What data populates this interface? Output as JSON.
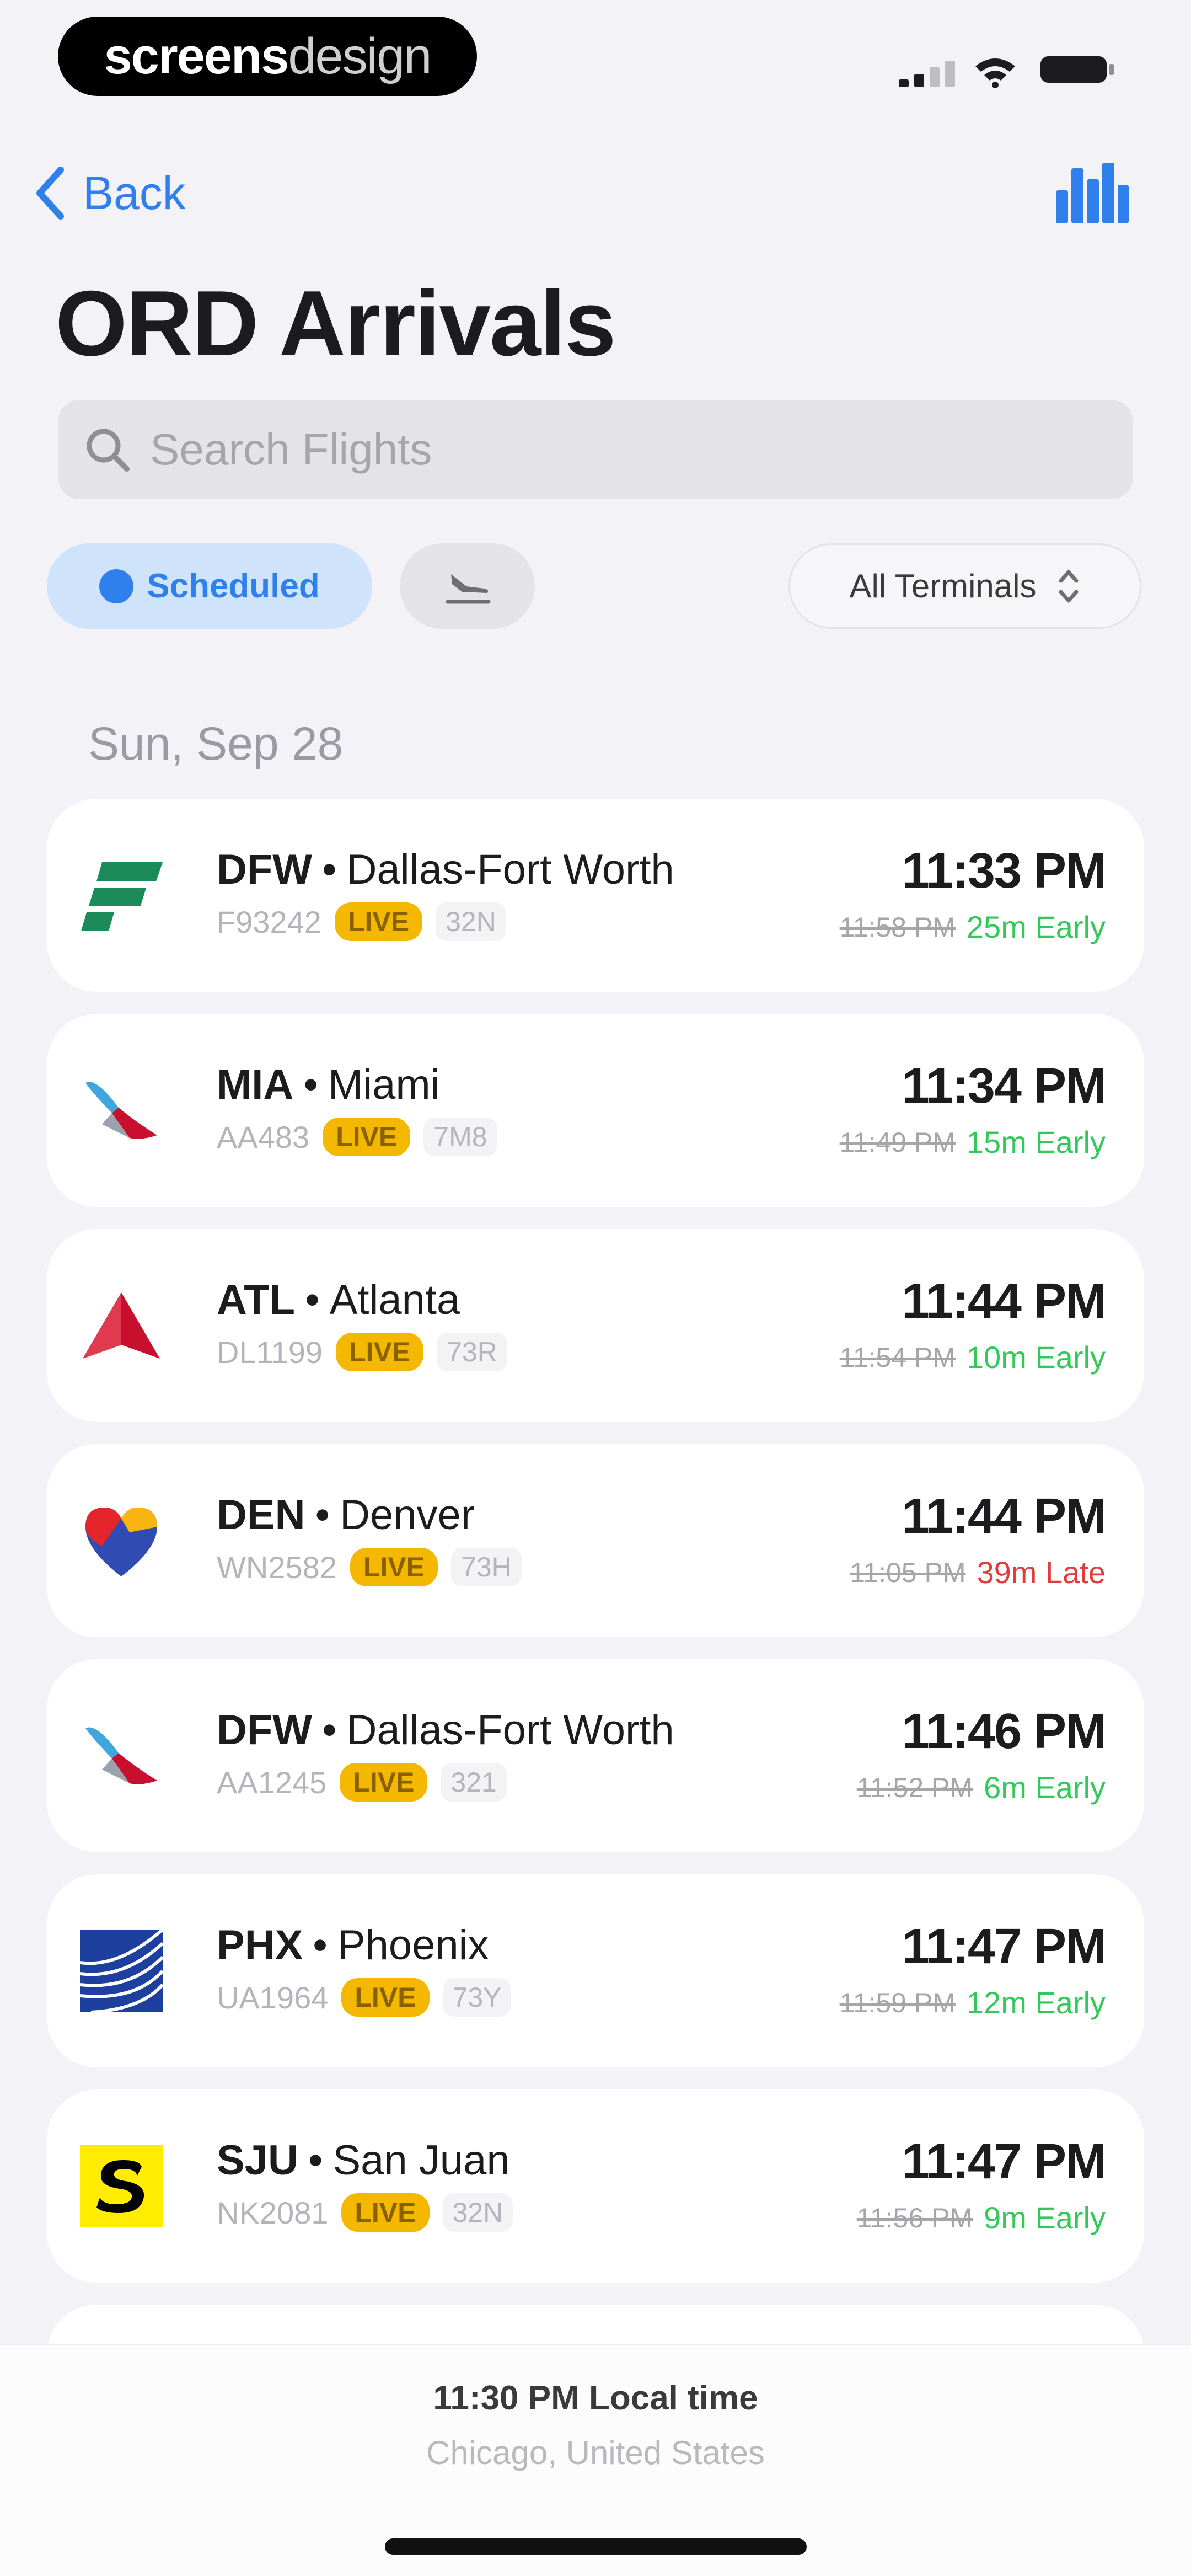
{
  "status_bar": {
    "brand_bold": "screens",
    "brand_light": "design"
  },
  "nav": {
    "back_label": "Back"
  },
  "page_title": "ORD Arrivals",
  "search": {
    "placeholder": "Search Flights"
  },
  "filters": {
    "scheduled_label": "Scheduled",
    "terminal_label": "All Terminals"
  },
  "section_date": "Sun, Sep 28",
  "flights": [
    {
      "code": "DFW",
      "city": "Dallas-Fort Worth",
      "flight": "F93242",
      "status": "LIVE",
      "aircraft": "32N",
      "time": "11:33 PM",
      "scheduled": "11:58 PM",
      "delta": "25m Early",
      "delta_type": "early",
      "airline_icon": "frontier-logo-icon"
    },
    {
      "code": "MIA",
      "city": "Miami",
      "flight": "AA483",
      "status": "LIVE",
      "aircraft": "7M8",
      "time": "11:34 PM",
      "scheduled": "11:49 PM",
      "delta": "15m Early",
      "delta_type": "early",
      "airline_icon": "american-airlines-logo-icon"
    },
    {
      "code": "ATL",
      "city": "Atlanta",
      "flight": "DL1199",
      "status": "LIVE",
      "aircraft": "73R",
      "time": "11:44 PM",
      "scheduled": "11:54 PM",
      "delta": "10m Early",
      "delta_type": "early",
      "airline_icon": "delta-logo-icon"
    },
    {
      "code": "DEN",
      "city": "Denver",
      "flight": "WN2582",
      "status": "LIVE",
      "aircraft": "73H",
      "time": "11:44 PM",
      "scheduled": "11:05 PM",
      "delta": "39m Late",
      "delta_type": "late",
      "airline_icon": "southwest-logo-icon"
    },
    {
      "code": "DFW",
      "city": "Dallas-Fort Worth",
      "flight": "AA1245",
      "status": "LIVE",
      "aircraft": "321",
      "time": "11:46 PM",
      "scheduled": "11:52 PM",
      "delta": "6m Early",
      "delta_type": "early",
      "airline_icon": "american-airlines-logo-icon"
    },
    {
      "code": "PHX",
      "city": "Phoenix",
      "flight": "UA1964",
      "status": "LIVE",
      "aircraft": "73Y",
      "time": "11:47 PM",
      "scheduled": "11:59 PM",
      "delta": "12m Early",
      "delta_type": "early",
      "airline_icon": "united-logo-icon"
    },
    {
      "code": "SJU",
      "city": "San Juan",
      "flight": "NK2081",
      "status": "LIVE",
      "aircraft": "32N",
      "time": "11:47 PM",
      "scheduled": "11:56 PM",
      "delta": "9m Early",
      "delta_type": "early",
      "airline_icon": "spirit-logo-icon"
    }
  ],
  "bottom_bar": {
    "local_time": "11:30 PM Local time",
    "location": "Chicago, United States"
  },
  "colors": {
    "accent": "#2F80ED",
    "live": "#F5B800",
    "early": "#34C759",
    "late": "#E23B3B"
  },
  "icons": [
    "chevron-left-icon",
    "bar-chart-icon",
    "search-icon",
    "landing-icon",
    "up-down-chevron-icon",
    "cellular-signal-icon",
    "wifi-icon",
    "battery-icon"
  ]
}
